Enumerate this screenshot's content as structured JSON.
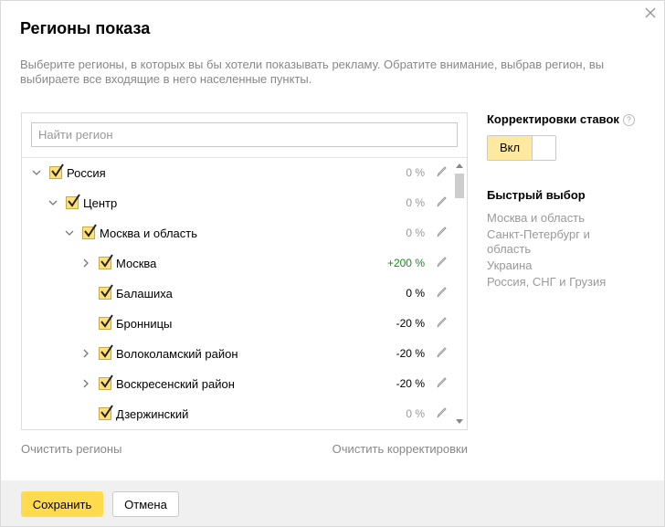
{
  "dialog": {
    "title": "Регионы показа",
    "description": "Выберите регионы, в которых вы бы хотели показывать рекламу. Обратите внимание, выбрав регион, вы выбираете все входящие в него населенные пункты."
  },
  "search": {
    "placeholder": "Найти регион",
    "value": ""
  },
  "tree": [
    {
      "label": "Россия",
      "pct": "0 %",
      "level": 0,
      "expander": "expanded",
      "checked": true,
      "pct_state": "zero"
    },
    {
      "label": "Центр",
      "pct": "0 %",
      "level": 1,
      "expander": "expanded",
      "checked": true,
      "pct_state": "zero"
    },
    {
      "label": "Москва и область",
      "pct": "0 %",
      "level": 2,
      "expander": "expanded",
      "checked": true,
      "pct_state": "zero"
    },
    {
      "label": "Москва",
      "pct": "+200 %",
      "level": 3,
      "expander": "collapsed",
      "checked": true,
      "pct_state": "up"
    },
    {
      "label": "Балашиха",
      "pct": "0 %",
      "level": 3,
      "expander": "none",
      "checked": true,
      "pct_state": "set"
    },
    {
      "label": "Бронницы",
      "pct": "-20 %",
      "level": 3,
      "expander": "none",
      "checked": true,
      "pct_state": "set"
    },
    {
      "label": "Волоколамский район",
      "pct": "-20 %",
      "level": 3,
      "expander": "collapsed",
      "checked": true,
      "pct_state": "set"
    },
    {
      "label": "Воскресенский район",
      "pct": "-20 %",
      "level": 3,
      "expander": "collapsed",
      "checked": true,
      "pct_state": "set"
    },
    {
      "label": "Дзержинский",
      "pct": "0 %",
      "level": 3,
      "expander": "none",
      "checked": true,
      "pct_state": "zero"
    }
  ],
  "links": {
    "clear_regions": "Очистить регионы",
    "clear_adjustments": "Очистить корректировки"
  },
  "bid_adjustments": {
    "title": "Корректировки ставок",
    "help_symbol": "?",
    "toggle_label": "Вкл",
    "toggle_on": true
  },
  "quick_select": {
    "title": "Быстрый выбор",
    "items": [
      "Москва и область",
      "Санкт-Петербург и область",
      "Украина",
      "Россия, СНГ и Грузия"
    ]
  },
  "footer": {
    "save_label": "Сохранить",
    "cancel_label": "Отмена"
  },
  "icons": {
    "close": "close-icon",
    "chevron_expanded": "chevron-down-icon",
    "chevron_collapsed": "chevron-right-icon",
    "checkbox": "checkmark-icon",
    "edit": "pencil-icon"
  },
  "colors": {
    "accent": "#ffdb4d",
    "checkbox_fill": "#ffe07a",
    "positive": "#1b8a23",
    "muted_text": "#888888",
    "footer_bg": "#f0f0f0"
  }
}
